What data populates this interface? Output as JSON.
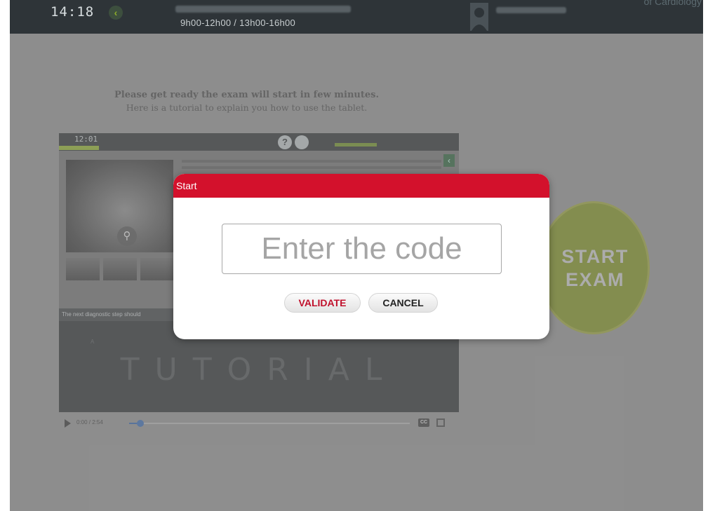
{
  "topbar": {
    "clock": "14:18",
    "session_hours": "9h00-12h00 / 13h00-16h00",
    "corner_text": "of Cardiology"
  },
  "page": {
    "intro_line1": "Please get ready the exam will start in few minutes.",
    "intro_line2": "Here is a tutorial to explain you how to use the tablet."
  },
  "tutorial": {
    "clock": "12:01",
    "question": "The next diagnostic step should",
    "watermark": "TUTORIAL",
    "option_a": "A",
    "controls": {
      "time": "0:00 / 2:54",
      "progress": 0.04,
      "cc_label": "CC"
    }
  },
  "start_exam": {
    "line1": "START",
    "line2": "EXAM"
  },
  "modal": {
    "title": "Start",
    "input_placeholder": "Enter the code",
    "input_value": "",
    "validate_label": "VALIDATE",
    "cancel_label": "CANCEL"
  },
  "colors": {
    "accent_red": "#d3112c",
    "exam_green": "#7c8f1e",
    "topbar_dark": "#2e3438"
  }
}
